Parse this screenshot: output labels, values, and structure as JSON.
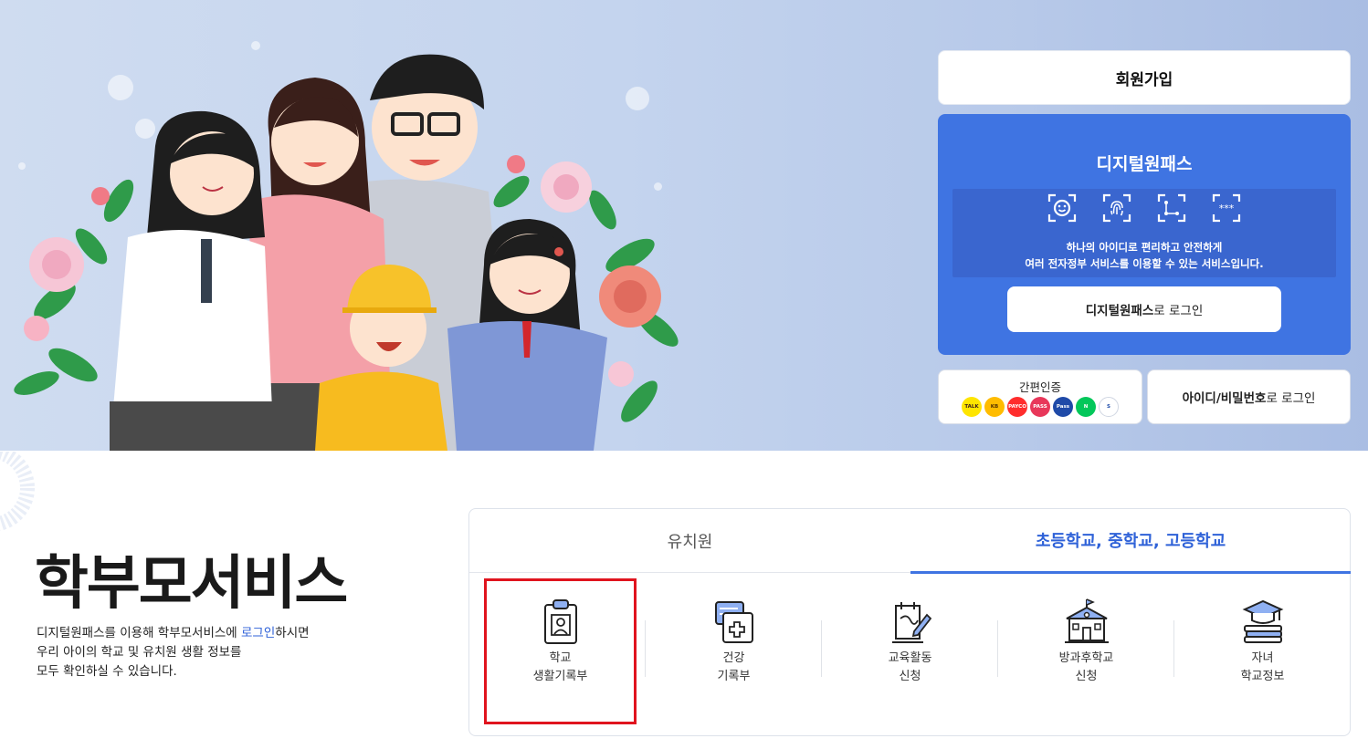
{
  "hero": {
    "join_label": "회원가입",
    "digital_pass": {
      "title": "디지털원패스",
      "desc_line1": "하나의 아이디로 편리하고 안전하게",
      "desc_line2": "여러 전자정부 서비스를 이용할 수 있는 서비스입니다.",
      "login_bold": "디지털원패스",
      "login_rest": "로 로그인",
      "icons": [
        "face-recognition-icon",
        "fingerprint-icon",
        "pattern-icon",
        "pin-icon"
      ]
    },
    "simple_auth": {
      "label": "간편인증",
      "providers": [
        {
          "name": "kakao",
          "text": "TALK",
          "bg": "#fee500",
          "fg": "#3a1d1d"
        },
        {
          "name": "kb",
          "text": "KB",
          "bg": "#ffbc00",
          "fg": "#553300"
        },
        {
          "name": "payco",
          "text": "PAYCO",
          "bg": "#ff2d2d",
          "fg": "#ffffff"
        },
        {
          "name": "pass",
          "text": "PASS",
          "bg": "#e8375a",
          "fg": "#ffffff"
        },
        {
          "name": "samsung-pass",
          "text": "Pass",
          "bg": "#1f4aa8",
          "fg": "#ffffff"
        },
        {
          "name": "naver",
          "text": "N",
          "bg": "#03c75a",
          "fg": "#ffffff"
        },
        {
          "name": "shinhan",
          "text": "S",
          "bg": "#ffffff",
          "fg": "#1e4ba8"
        }
      ]
    },
    "id_login_bold": "아이디/비밀번호",
    "id_login_rest": "로 로그인"
  },
  "service": {
    "title": "학부모서비스",
    "desc_pre": "디지털원패스를 이용해 학부모서비스에 ",
    "desc_link": "로그인",
    "desc_post": "하시면",
    "desc_line2": "우리 아이의 학교 및 유치원 생활 정보를",
    "desc_line3": "모두 확인하실 수 있습니다.",
    "tabs": [
      {
        "label": "유치원",
        "active": false
      },
      {
        "label": "초등학교, 중학교, 고등학교",
        "active": true
      }
    ],
    "items": [
      {
        "line1": "학교",
        "line2": "생활기록부",
        "icon": "school-record-icon"
      },
      {
        "line1": "건강",
        "line2": "기록부",
        "icon": "health-record-icon"
      },
      {
        "line1": "교육활동",
        "line2": "신청",
        "icon": "education-activity-icon"
      },
      {
        "line1": "방과후학교",
        "line2": "신청",
        "icon": "after-school-icon"
      },
      {
        "line1": "자녀",
        "line2": "학교정보",
        "icon": "school-info-icon"
      }
    ]
  },
  "colors": {
    "accent": "#3f74e2",
    "link": "#2f62d8",
    "highlight": "#e0141e"
  }
}
